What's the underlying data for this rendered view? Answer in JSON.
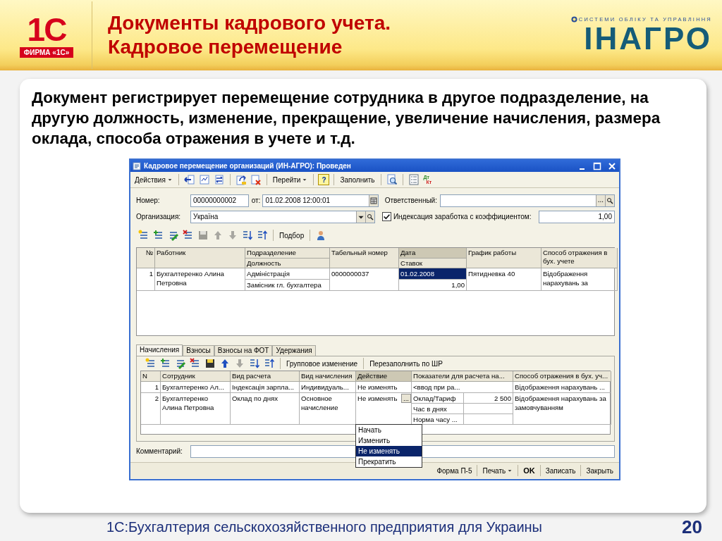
{
  "slide": {
    "logo_left": {
      "mark": "1С",
      "caption": "ФИРМА «1С»"
    },
    "title": [
      "Документы кадрового учета.",
      "Кадровое перемещение"
    ],
    "logo_right": {
      "tagline": "СИСТЕМИ ОБЛІКУ ТА УПРАВЛІННЯ",
      "name": "ІНАГРО"
    },
    "description": "Документ регистрирует перемещение сотрудника в другое подразделение, на другую должность, изменение, прекращение, увеличение начисления, размера оклада, способа отражения в учете и т.д.",
    "footer": {
      "product": "1С:Бухгалтерия сельскохозяйственного предприятия для Украины",
      "page": "20"
    }
  },
  "window": {
    "title": "Кадровое перемещение организаций (ИН-АГРО): Проведен",
    "toolbar": [
      {
        "kind": "menu",
        "label": "Действия"
      },
      {
        "kind": "separator"
      },
      {
        "kind": "icon",
        "disabled": false
      },
      {
        "kind": "icon",
        "disabled": false
      },
      {
        "kind": "icon",
        "disabled": false
      },
      {
        "kind": "separator"
      },
      {
        "kind": "icon",
        "disabled": false
      },
      {
        "kind": "icon",
        "disabled": false
      },
      {
        "kind": "separator"
      },
      {
        "kind": "menu",
        "label": "Перейти"
      },
      {
        "kind": "separator"
      },
      {
        "kind": "help",
        "label": "?"
      },
      {
        "kind": "separator"
      },
      {
        "kind": "button",
        "label": "Заполнить"
      },
      {
        "kind": "separator"
      },
      {
        "kind": "icon",
        "disabled": false
      },
      {
        "kind": "separator"
      },
      {
        "kind": "icon",
        "disabled": false
      },
      {
        "kind": "dtkt",
        "label": "Дт",
        "sublabel": "Кт"
      }
    ],
    "fields": {
      "number": {
        "label": "Номер:",
        "value": "00000000002"
      },
      "date": {
        "label": "от:",
        "value": "01.02.2008 12:00:01"
      },
      "responsible": {
        "label": "Ответственный:",
        "button": "..."
      },
      "organization": {
        "label": "Организация:",
        "value": "Україна"
      },
      "indexation": {
        "label": "Индексация заработка с коэффициентом:",
        "checked": true,
        "value": "1,00"
      }
    },
    "employees_toolbar": [
      {
        "kind": "icon",
        "disabled": false
      },
      {
        "kind": "icon",
        "disabled": false
      },
      {
        "kind": "icon",
        "disabled": false
      },
      {
        "kind": "icon",
        "disabled": false
      },
      {
        "kind": "icon",
        "disabled": true
      },
      {
        "kind": "icon",
        "disabled": true
      },
      {
        "kind": "icon",
        "disabled": true
      },
      {
        "kind": "icon",
        "disabled": false
      },
      {
        "kind": "icon",
        "disabled": false
      },
      {
        "kind": "separator"
      },
      {
        "kind": "button",
        "label": "Подбор"
      },
      {
        "kind": "separator"
      },
      {
        "kind": "icon",
        "disabled": false
      }
    ],
    "employees": {
      "columns": [
        {
          "header": "№",
          "selected": false
        },
        {
          "header": "Работник",
          "selected": false
        },
        {
          "header": "Подразделение",
          "subheader": "Должность",
          "selected": false
        },
        {
          "header": "Табельный номер",
          "selected": false
        },
        {
          "header": "Дата",
          "subheader": "Ставок",
          "selected": true
        },
        {
          "header": "График работы",
          "selected": false
        },
        {
          "header": "Способ отражения в бух. учете",
          "selected": false
        }
      ],
      "rows": [
        {
          "cells": [
            {
              "text": "1",
              "selected": false
            },
            {
              "text": "Бухгалтеренко Алина Петровна",
              "selected": false
            },
            {
              "text": "Адміністрація",
              "subtext": "Замісник гл. бухгалтера",
              "selected": false
            },
            {
              "text": "0000000037",
              "selected": false
            },
            {
              "text": "01.02.2008",
              "subtext": "1,00",
              "selected": true
            },
            {
              "text": "Пятидневка 40",
              "selected": false
            },
            {
              "text": "Відображення нарахувань за",
              "selected": false
            }
          ]
        }
      ]
    },
    "tabs": [
      {
        "label": "Начисления",
        "selected": true
      },
      {
        "label": "Взносы",
        "selected": false
      },
      {
        "label": "Взносы на ФОТ",
        "selected": false
      },
      {
        "label": "Удержания",
        "selected": false
      }
    ],
    "accruals_toolbar": [
      {
        "kind": "icon",
        "disabled": false
      },
      {
        "kind": "icon",
        "disabled": false
      },
      {
        "kind": "icon",
        "disabled": false
      },
      {
        "kind": "icon",
        "disabled": false
      },
      {
        "kind": "icon",
        "disabled": false
      },
      {
        "kind": "icon",
        "disabled": false
      },
      {
        "kind": "icon",
        "disabled": true
      },
      {
        "kind": "icon",
        "disabled": false
      },
      {
        "kind": "icon",
        "disabled": false
      },
      {
        "kind": "separator"
      },
      {
        "kind": "button",
        "label": "Групповое изменение"
      },
      {
        "kind": "separator"
      },
      {
        "kind": "button",
        "label": "Перезаполнить по ШР"
      }
    ],
    "accruals": {
      "columns": [
        {
          "header": "N",
          "selected": false
        },
        {
          "header": "Сотрудник",
          "selected": false
        },
        {
          "header": "Вид расчета",
          "selected": false
        },
        {
          "header": "Вид начисления",
          "selected": false
        },
        {
          "header": "Действие",
          "selected": true
        },
        {
          "header": "Показатели для расчета на...",
          "selected": false
        },
        {
          "header": "Способ отражения в бух. уч...",
          "selected": false
        }
      ],
      "rows": [
        {
          "number": "1",
          "employee": "Бухгалтеренко Ал...",
          "calc_type": "Індексація зарпла...",
          "accrual_type": "Индивидуаль...",
          "action": "Не изменять",
          "indicators": [
            {
              "kind": "wide",
              "name": "<ввод при ра..."
            }
          ],
          "reflection": "Відображення нарахувань ..."
        },
        {
          "number": "2",
          "employee": "Бухгалтеренко Алина Петровна",
          "calc_type": "Оклад по днях",
          "accrual_type": "Основное начисление",
          "action": "Не изменять",
          "action_button": "...",
          "indicators": [
            {
              "kind": "pair",
              "name": "Оклад/Тариф",
              "value": "2 500"
            },
            {
              "kind": "pair",
              "name": "Час в днях"
            },
            {
              "kind": "pair",
              "name": "Норма часу ..."
            }
          ],
          "reflection": "Відображення нарахувань за замовчуванням"
        }
      ],
      "dropdown": [
        {
          "label": "Начать",
          "selected": false
        },
        {
          "label": "Изменить",
          "selected": false
        },
        {
          "label": "Не изменять",
          "selected": true
        },
        {
          "label": "Прекратить",
          "selected": false
        }
      ]
    },
    "comment": {
      "label": "Комментарий:"
    },
    "buttons": [
      {
        "kind": "plain",
        "label": "Форма П-5"
      },
      {
        "kind": "menu",
        "label": "Печать"
      },
      {
        "kind": "default",
        "label": "OK"
      },
      {
        "kind": "plain",
        "label": "Записать"
      },
      {
        "kind": "plain",
        "label": "Закрыть"
      }
    ]
  }
}
